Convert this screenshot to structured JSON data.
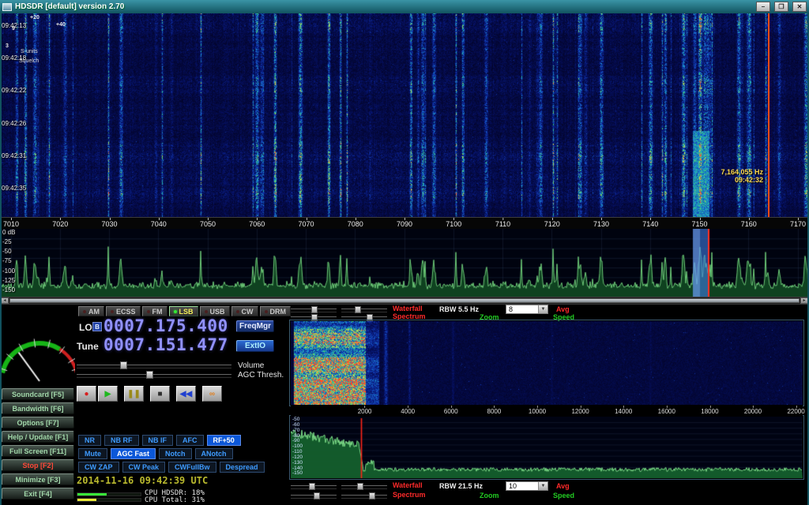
{
  "window": {
    "title": "HDSDR [default]  version 2.70"
  },
  "titlebar": {
    "minimize": "–",
    "maximize": "❐",
    "close": "✕"
  },
  "icons": {
    "dropdown": "▼",
    "scroll_left": "◂",
    "scroll_right": "▸"
  },
  "waterfall": {
    "time_labels": [
      "09:42:13",
      "09:42:18",
      "09:42:22",
      "09:42:26",
      "09:42:31",
      "09:42:35"
    ],
    "marker_freq": "7,164,055 Hz",
    "marker_time": "09:42:32"
  },
  "freq_scale": {
    "ticks": [
      "7010",
      "7020",
      "7030",
      "7040",
      "7050",
      "7060",
      "7070",
      "7080",
      "7090",
      "7100",
      "7110",
      "7120",
      "7130",
      "7140",
      "7150",
      "7160",
      "7170"
    ]
  },
  "spectrum": {
    "db_labels": [
      "0 dB",
      "-25",
      "-50",
      "-75",
      "-100",
      "-125",
      "-150"
    ]
  },
  "smeter": {
    "labels": [
      "3",
      "9",
      "+20",
      "+40"
    ],
    "units": "S-units",
    "squelch": "Squelch"
  },
  "modes": [
    {
      "label": "AM"
    },
    {
      "label": "ECSS"
    },
    {
      "label": "FM"
    },
    {
      "label": "LSB",
      "active": true
    },
    {
      "label": "USB"
    },
    {
      "label": "CW"
    },
    {
      "label": "DRM"
    }
  ],
  "vfo": {
    "lo_label": "LO",
    "lo_band": "B",
    "lo_value": "0007.175.400",
    "tune_label": "Tune",
    "tune_value": "0007.151.477",
    "freqmgr": "FreqMgr",
    "extio": "ExtIO",
    "volume_label": "Volume",
    "agc_label": "AGC Thresh."
  },
  "transport": [
    {
      "name": "record",
      "glyph": "●",
      "color": "#d81f1f"
    },
    {
      "name": "play",
      "glyph": "▶",
      "color": "#1fb81f"
    },
    {
      "name": "pause",
      "glyph": "❚❚",
      "color": "#9a8a1a"
    },
    {
      "name": "stop",
      "glyph": "■",
      "color": "#2e2e2e"
    },
    {
      "name": "rewind",
      "glyph": "◀◀",
      "color": "#2040d0"
    },
    {
      "name": "loop",
      "glyph": "∞",
      "color": "#e08020"
    }
  ],
  "dsp": {
    "row1": [
      {
        "label": "NR"
      },
      {
        "label": "NB RF"
      },
      {
        "label": "NB IF"
      },
      {
        "label": "AFC"
      },
      {
        "label": "RF+50",
        "active": true
      }
    ],
    "row2": [
      {
        "label": "Mute"
      },
      {
        "label": "AGC Fast",
        "active": true
      },
      {
        "label": "Notch"
      },
      {
        "label": "ANotch"
      }
    ],
    "row3": [
      {
        "label": "CW ZAP"
      },
      {
        "label": "CW Peak"
      },
      {
        "label": "CWFullBw"
      },
      {
        "label": "Despread"
      }
    ]
  },
  "sidebar": [
    {
      "label": "Soundcard  [F5]",
      "name": "soundcard"
    },
    {
      "label": "Bandwidth  [F6]",
      "name": "bandwidth"
    },
    {
      "label": "Options  [F7]",
      "name": "options"
    },
    {
      "label": "Help / Update  [F1]",
      "name": "help-update"
    },
    {
      "label": "Full Screen  [F11]",
      "name": "full-screen"
    },
    {
      "label": "Stop  [F2]",
      "cls": "red",
      "name": "stop"
    },
    {
      "label": "Minimize  [F3]",
      "name": "minimize"
    },
    {
      "label": "Exit  [F4]",
      "name": "exit"
    }
  ],
  "status": {
    "datetime": "2014-11-16  09:42:39 UTC",
    "cpu_hdsdr": "CPU HDSDR: 18%",
    "cpu_total": "CPU Total: 31%"
  },
  "right_panel": {
    "top": {
      "waterfall": "Waterfall",
      "spectrum": "Spectrum",
      "rbw": "RBW  5.5 Hz",
      "avg_value": "8",
      "avg": "Avg",
      "zoom": "Zoom",
      "speed": "Speed"
    },
    "bottom": {
      "waterfall": "Waterfall",
      "spectrum": "Spectrum",
      "rbw": "RBW 21.5 Hz",
      "avg_value": "10",
      "avg": "Avg",
      "zoom": "Zoom",
      "speed": "Speed"
    },
    "audio_freq_ticks": [
      "2000",
      "4000",
      "6000",
      "8000",
      "10000",
      "12000",
      "14000",
      "16000",
      "18000",
      "20000",
      "22000"
    ],
    "audio_db_labels": [
      "-50",
      "-60",
      "-70",
      "-80",
      "-90",
      "-100",
      "-110",
      "-120",
      "-130",
      "-140",
      "-150"
    ]
  },
  "colors": {
    "digit_blue": "#9191ff",
    "label_red": "#ff2a2a",
    "label_green": "#22cc22",
    "marker_yellow": "#ffd84a",
    "accent_blue": "#0b57d8"
  }
}
